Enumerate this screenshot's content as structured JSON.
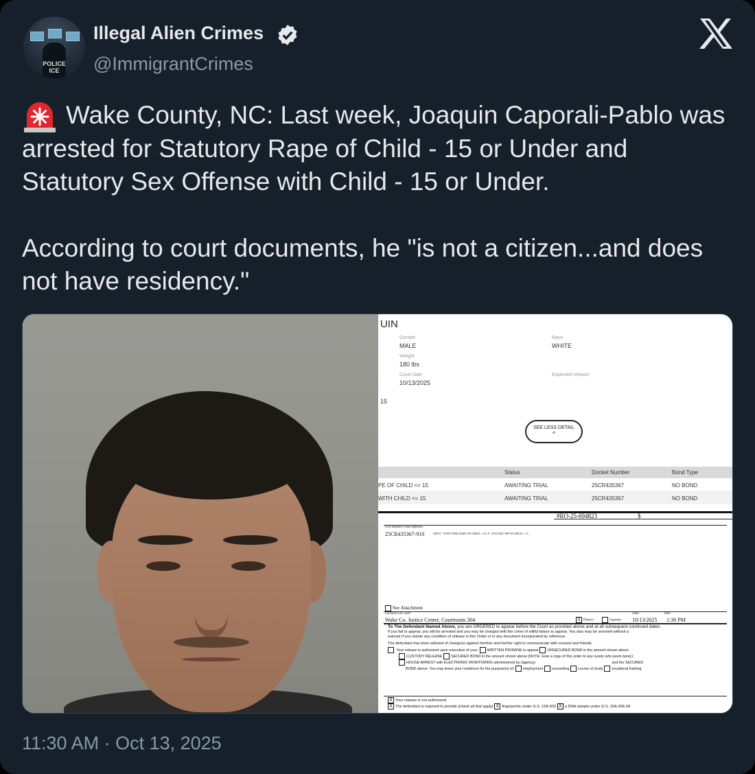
{
  "account": {
    "display_name": "Illegal Alien Crimes",
    "handle": "@ImmigrantCrimes",
    "avatar_text_line1": "POLICE",
    "avatar_text_line2": "ICE",
    "icons": [
      "verified-badge-icon",
      "x-logo-icon"
    ],
    "badge_color": "#1d9bf0"
  },
  "tweet": {
    "paragraph1": "Wake County, NC: Last week, Joaquin Caporali-Pablo was arrested for Statutory Rape of Child - 15 or Under and Statutory Sex Offense with Child - 15 or Under.",
    "paragraph2": "According to court documents, he \"is not a citizen...and does not have residency.\"",
    "emoji": "siren-icon",
    "timestamp": "11:30 AM · Oct 13, 2025"
  },
  "doc1": {
    "header": "UIN",
    "gender_label": "Gender",
    "gender": "MALE",
    "race_label": "Race",
    "race": "WHITE",
    "weight_label": "Weight",
    "weight": "180 lbs",
    "court_date_label": "Court date",
    "court_date": "10/13/2025",
    "expected_release_label": "Expected release",
    "stray": "15",
    "button_label": "SEE LESS DETAIL",
    "button_chevron": "^",
    "table": {
      "headers": [
        "Status",
        "Docket Number",
        "Bond Type"
      ],
      "rows": [
        {
          "charge": "PE OF CHILD <= 15",
          "status": "AWAITING TRIAL",
          "docket": "25CR435367",
          "bond": "NO BOND"
        },
        {
          "charge": "WITH CHILD <= 15",
          "status": "AWAITING TRIAL",
          "docket": "25CR435367",
          "bond": "NO BOND"
        }
      ]
    }
  },
  "doc2": {
    "ro_number": "#RO-25-694823",
    "dollar": "$",
    "files_label": "File Numbers And Offenses",
    "file_number": "25CR435367-910",
    "offense_text": "WPA F - STATUTORY RAPE OF CHILD <=15; F - STAT SEX OFF W/CHILD<= 15",
    "see_attachment": "See Attachment",
    "location_label": "Location Of Court",
    "location": "Wake Co. Justice Center, Courtroom 304",
    "district": "District",
    "superior": "Superior",
    "date_label": "Date",
    "date": "10/13/2025",
    "time_label": "Time",
    "time": "1:30 PM",
    "order_bold": "To The Defendant Named Above,",
    "order_text": "you are ORDERED to appear before the Court as provided above and at all subsequent continued dates.",
    "line2": "If you fail to appear, you will be arrested and you may be charged with the crime of willful failure to appear. You also may be arrested without a",
    "line3": "warrant if you violate any condition of release in this Order or in any document incorporated by reference.",
    "line4": "The defendant has been advised of charge(s) against him/her and his/her right to communicate with counsel and friends.",
    "opt1": "Your release is authorized upon execution of your:",
    "opt1b": "WRITTEN PROMISE to appear",
    "opt1c": "UNSECURED BOND in the amount shown above",
    "opt2": "CUSTODY RELEASE",
    "opt2b": "SECURED BOND in the amount shown above (NOTE:",
    "opt2c": "Give a copy of this order to any surety who posts bond.)",
    "opt3": "HOUSE ARREST with ELECTRONIC MONITORING administered by",
    "opt3b": "(agency)",
    "opt3c": "and the SECURED",
    "opt4": "BOND above. You may leave your residence for the purpose(s) of:",
    "opt4b": "employment",
    "opt4c": "counseling",
    "opt4d": "course of study",
    "opt4e": "vocational training",
    "not_authorized": "Your release is not authorized.",
    "required": "The defendant is required to provide",
    "required_b": "(check all that apply)",
    "fingerprints": "fingerprints under G.S. 15A-502",
    "dna": "a DNA sample under G.S. 15A-266.3A"
  }
}
